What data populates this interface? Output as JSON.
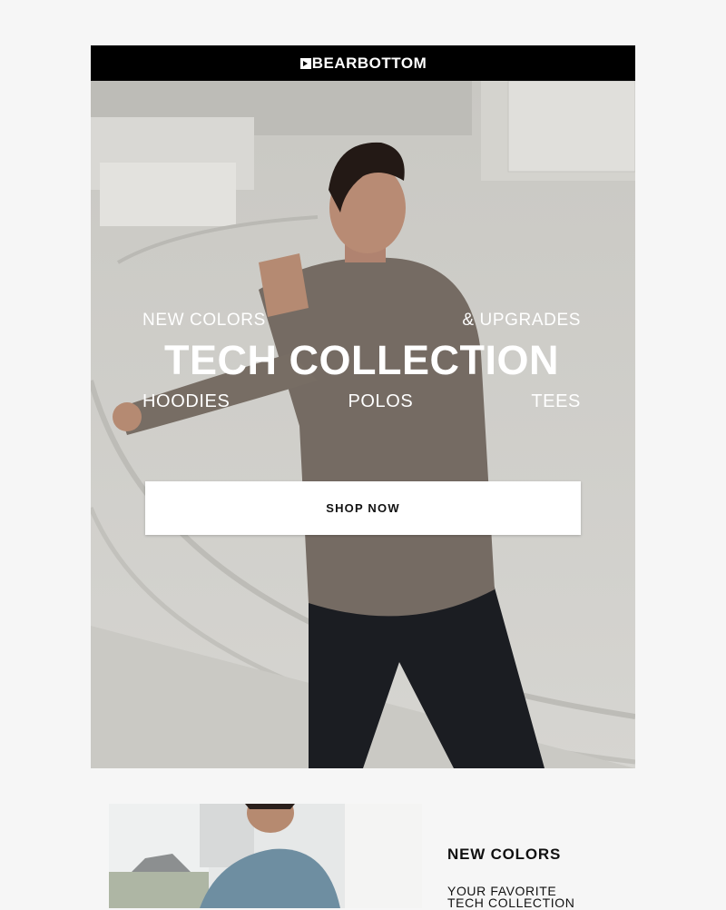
{
  "brand": {
    "name": "BEARBOTTOM",
    "bar_color": "#000000"
  },
  "hero": {
    "tag_left": "NEW COLORS",
    "tag_right": "& UPGRADES",
    "headline": "TECH COLLECTION",
    "categories": [
      "HOODIES",
      "POLOS",
      "TEES"
    ],
    "cta": "SHOP NOW"
  },
  "promo": {
    "title": "NEW COLORS",
    "desc_line1": "YOUR FAVORITE",
    "desc_line2": "TECH COLLECTION"
  }
}
